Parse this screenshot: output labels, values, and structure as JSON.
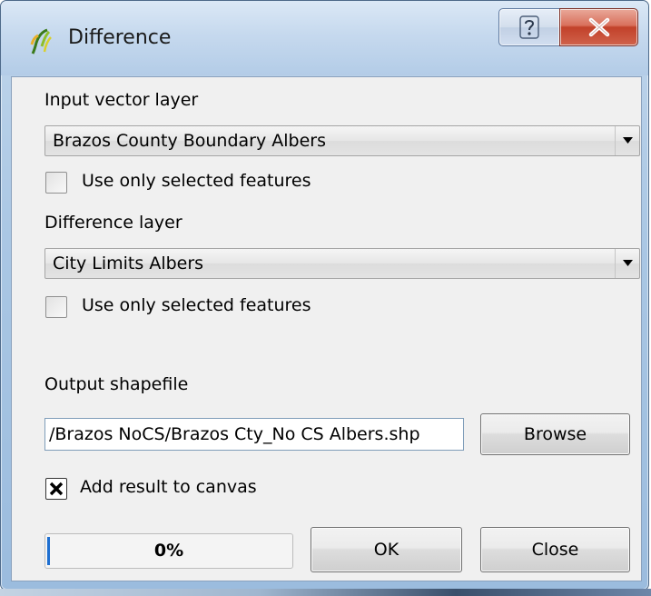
{
  "window": {
    "title": "Difference",
    "help_icon": "help-icon",
    "close_icon": "close-icon",
    "app_icon": "qgis-icon"
  },
  "input_layer": {
    "label": "Input vector layer",
    "selected": "Brazos County Boundary Albers",
    "selected_only_label": "Use only selected features",
    "selected_only_checked": false
  },
  "difference_layer": {
    "label": "Difference layer",
    "selected": "City Limits Albers",
    "selected_only_label": "Use only selected features",
    "selected_only_checked": false
  },
  "output": {
    "label": "Output shapefile",
    "path": "/Brazos NoCS/Brazos Cty_No CS Albers.shp",
    "browse_label": "Browse",
    "add_to_canvas_label": "Add result to canvas",
    "add_to_canvas_checked": true
  },
  "progress": {
    "text": "0%",
    "value": 0
  },
  "buttons": {
    "ok": "OK",
    "close": "Close"
  },
  "colors": {
    "progress_fill": "#1e6fd0",
    "close_button": "#c2412a"
  }
}
